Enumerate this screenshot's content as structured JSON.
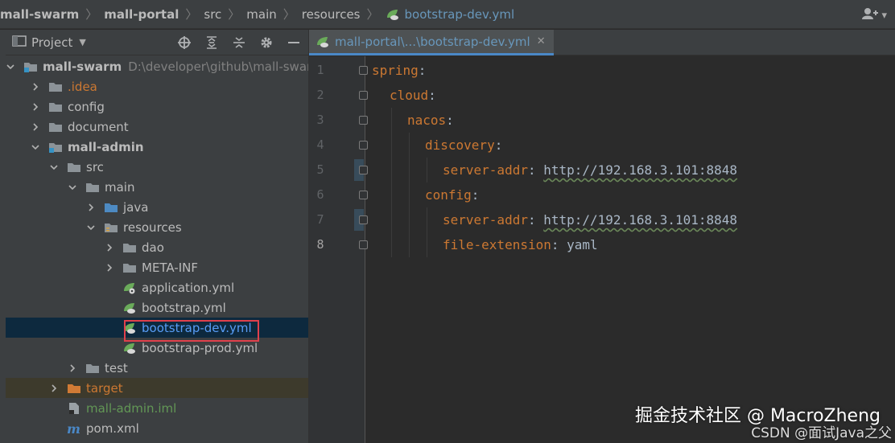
{
  "breadcrumb": {
    "items": [
      "mall-swarm",
      "mall-portal",
      "src",
      "main",
      "resources",
      "bootstrap-dev.yml"
    ]
  },
  "project_panel": {
    "title": "Project",
    "tools": [
      "locate-icon",
      "expand-all-icon",
      "collapse-all-icon",
      "gear-icon",
      "minimize-icon"
    ]
  },
  "tree": [
    {
      "label": "mall-swarm",
      "hint": "D:\\developer\\github\\mall-swar",
      "state": "open",
      "icon": "module-folder",
      "indent": 0,
      "style": "bold"
    },
    {
      "label": ".idea",
      "state": "closed",
      "icon": "folder",
      "indent": 1,
      "style": "idea"
    },
    {
      "label": "config",
      "state": "closed",
      "icon": "folder",
      "indent": 1,
      "style": ""
    },
    {
      "label": "document",
      "state": "closed",
      "icon": "folder",
      "indent": 1,
      "style": ""
    },
    {
      "label": "mall-admin",
      "state": "open",
      "icon": "module-folder",
      "indent": 1,
      "style": "bold"
    },
    {
      "label": "src",
      "state": "open",
      "icon": "folder",
      "indent": 2,
      "style": ""
    },
    {
      "label": "main",
      "state": "open",
      "icon": "folder",
      "indent": 3,
      "style": ""
    },
    {
      "label": "java",
      "state": "closed",
      "icon": "source-folder",
      "indent": 4,
      "style": ""
    },
    {
      "label": "resources",
      "state": "open",
      "icon": "resources-folder",
      "indent": 4,
      "style": ""
    },
    {
      "label": "dao",
      "state": "closed",
      "icon": "folder",
      "indent": 5,
      "style": ""
    },
    {
      "label": "META-INF",
      "state": "closed",
      "icon": "folder",
      "indent": 5,
      "style": ""
    },
    {
      "label": "application.yml",
      "state": "none",
      "icon": "spring-config",
      "indent": 5,
      "style": ""
    },
    {
      "label": "bootstrap.yml",
      "state": "none",
      "icon": "spring-cloud",
      "indent": 5,
      "style": ""
    },
    {
      "label": "bootstrap-dev.yml",
      "state": "none",
      "icon": "spring-cloud",
      "indent": 5,
      "style": "selected"
    },
    {
      "label": "bootstrap-prod.yml",
      "state": "none",
      "icon": "spring-cloud",
      "indent": 5,
      "style": ""
    },
    {
      "label": "test",
      "state": "closed",
      "icon": "folder",
      "indent": 3,
      "style": ""
    },
    {
      "label": "target",
      "state": "closed",
      "icon": "excluded-folder",
      "indent": 2,
      "style": "target"
    },
    {
      "label": "mall-admin.iml",
      "state": "none",
      "icon": "iml-file",
      "indent": 2,
      "style": "green"
    },
    {
      "label": "pom.xml",
      "state": "none",
      "icon": "maven-file",
      "indent": 2,
      "style": ""
    }
  ],
  "editor": {
    "tab_label": "mall-portal\\...\\bootstrap-dev.yml",
    "lines": [
      {
        "num": "1",
        "indent": 0,
        "key": "spring",
        "sep": ":",
        "value": ""
      },
      {
        "num": "2",
        "indent": 1,
        "key": "cloud",
        "sep": ":",
        "value": ""
      },
      {
        "num": "3",
        "indent": 2,
        "key": "nacos",
        "sep": ":",
        "value": ""
      },
      {
        "num": "4",
        "indent": 3,
        "key": "discovery",
        "sep": ":",
        "value": ""
      },
      {
        "num": "5",
        "indent": 4,
        "key": "server-addr",
        "sep": ": ",
        "value": "http://192.168.3.101:8848"
      },
      {
        "num": "6",
        "indent": 3,
        "key": "config",
        "sep": ":",
        "value": ""
      },
      {
        "num": "7",
        "indent": 4,
        "key": "server-addr",
        "sep": ": ",
        "value": "http://192.168.3.101:8848"
      },
      {
        "num": "8",
        "indent": 4,
        "key": "file-extension",
        "sep": ": ",
        "value": "yaml"
      }
    ]
  },
  "watermark": {
    "line1": "掘金技术社区 @ MacroZheng",
    "line2": "CSDN @面试Java之父"
  },
  "colors": {
    "accent": "#4a88c7",
    "yaml_key": "#cc7832",
    "selection": "#0d293e",
    "highlight_border": "#e0404c"
  }
}
